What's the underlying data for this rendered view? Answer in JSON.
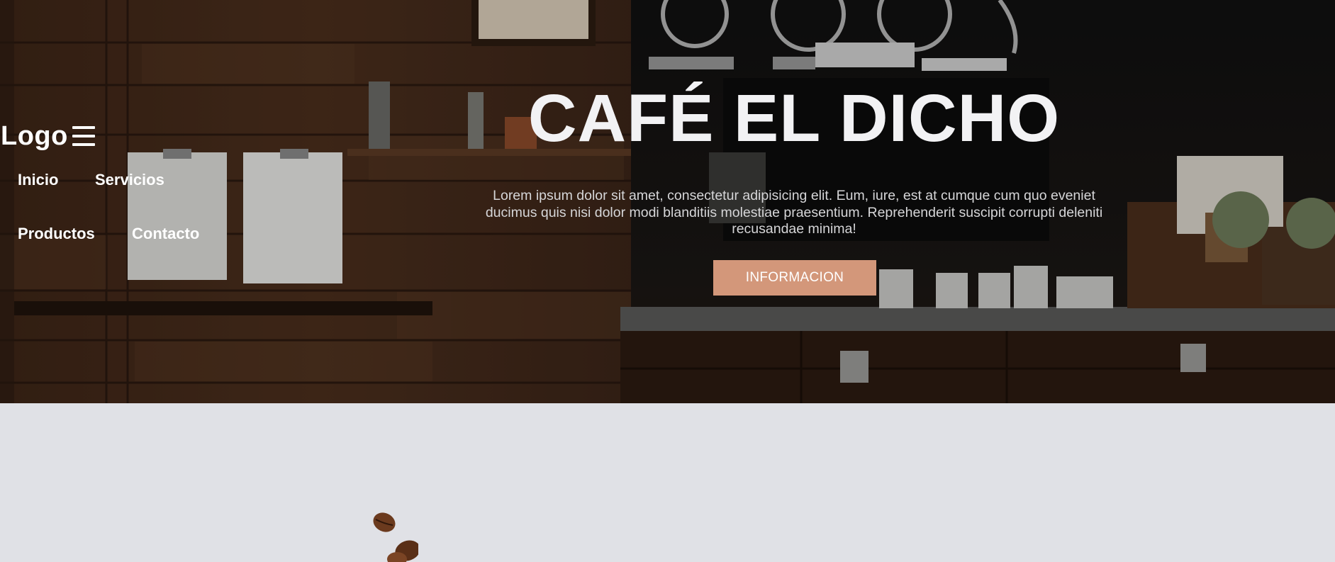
{
  "header": {
    "logo": "Logo",
    "menu_icon": "hamburger-menu-icon",
    "nav": {
      "inicio": "Inicio",
      "servicios": "Servicios",
      "productos": "Productos",
      "contacto": "Contacto"
    }
  },
  "hero": {
    "title": "CAFÉ EL DICHO",
    "text": "Lorem ipsum dolor sit amet, consectetur adipisicing elit. Eum, iure, est at cumque cum quo eveniet ducimus quis nisi dolor modi blanditiis molestiae praesentium. Reprehenderit suscipit corrupti deleniti recusandae minima!",
    "button_label": "INFORMACION",
    "background_image": "cafe-interior-photo"
  },
  "colors": {
    "accent": "#d3977a",
    "page_background": "#e0e1e6",
    "text_light": "#ffffff"
  },
  "lower": {
    "image": "coffee-beans-image"
  }
}
